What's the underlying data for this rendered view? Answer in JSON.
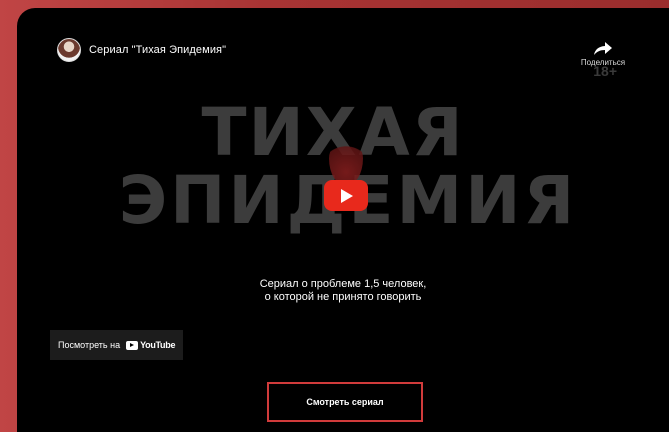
{
  "player": {
    "channel_avatar": "channel-avatar",
    "title": "Сериал \"Тихая Эпидемия\"",
    "share_label": "Поделиться",
    "share_icon": "share-arrow-icon",
    "age_rating": "18+",
    "play_icon": "youtube-play-icon",
    "watch_on_label": "Посмотреть на",
    "youtube_brand": "YouTube"
  },
  "hero": {
    "line1": "ТИХАЯ",
    "line2": "ЭПИДЕМИЯ"
  },
  "description": {
    "line1": "Сериал о проблеме 1,5 человек,",
    "line2": "о которой не принято говорить"
  },
  "cta": {
    "label": "Смотреть сериал"
  },
  "colors": {
    "background_red": "#b33a3a",
    "youtube_red": "#e8291c",
    "cta_border": "#d13b3b"
  }
}
